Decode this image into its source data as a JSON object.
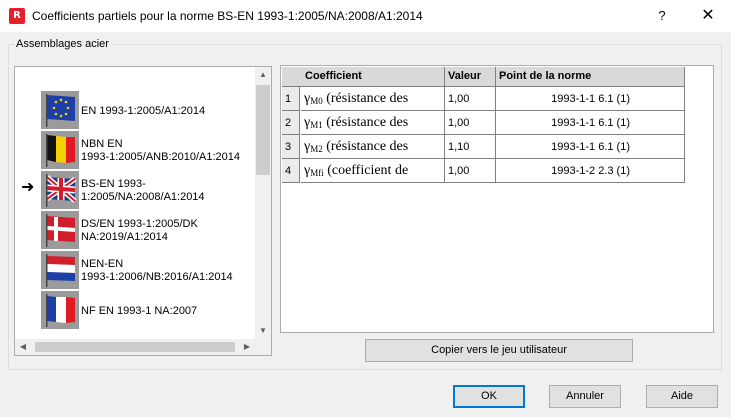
{
  "window": {
    "app_icon_letter": "R",
    "title": "Coefficients partiels pour la norme BS-EN 1993-1:2005/NA:2008/A1:2014",
    "help_glyph": "?",
    "close_glyph": "✕"
  },
  "group": {
    "label": "Assemblages acier"
  },
  "norms": [
    {
      "label": "EN 1993-1:2005/A1:2014",
      "flag": "eu-flag-icon",
      "selected": false
    },
    {
      "label": "NBN EN\n1993-1:2005/ANB:2010/A1:2014",
      "flag": "belgium-flag-icon",
      "selected": false
    },
    {
      "label": "BS-EN 1993-1:2005/NA:2008/A1:2014",
      "flag": "uk-flag-icon",
      "selected": true
    },
    {
      "label": "DS/EN 1993-1:2005/DK\nNA:2019/A1:2014",
      "flag": "denmark-flag-icon",
      "selected": false
    },
    {
      "label": "NEN-EN\n1993-1:2006/NB:2016/A1:2014",
      "flag": "netherlands-flag-icon",
      "selected": false
    },
    {
      "label": "NF EN 1993-1 NA:2007",
      "flag": "france-flag-icon",
      "selected": false
    }
  ],
  "selection_arrow": "➜",
  "table": {
    "headers": {
      "coefficient": "Coefficient",
      "value": "Valeur",
      "reference": "Point de la norme"
    },
    "rows": [
      {
        "num": "1",
        "symbol": "γ",
        "sub": "M0",
        "text": " (résistance des",
        "value": "1,00",
        "ref": "1993-1-1  6.1 (1)"
      },
      {
        "num": "2",
        "symbol": "γ",
        "sub": "M1",
        "text": " (résistance des",
        "value": "1,00",
        "ref": "1993-1-1  6.1 (1)"
      },
      {
        "num": "3",
        "symbol": "γ",
        "sub": "M2",
        "text": " (résistance des",
        "value": "1,10",
        "ref": "1993-1-1  6.1 (1)"
      },
      {
        "num": "4",
        "symbol": "γ",
        "sub": "Mfi",
        "text": " (coefficient de",
        "value": "1,00",
        "ref": "1993-1-2  2.3 (1)"
      }
    ]
  },
  "buttons": {
    "copy": "Copier vers le jeu utilisateur",
    "ok": "OK",
    "cancel": "Annuler",
    "help": "Aide"
  },
  "colors": {
    "title_icon": "#e6202b",
    "default_button_border": "#0078d7",
    "header_bg": "#d9d9d9"
  }
}
